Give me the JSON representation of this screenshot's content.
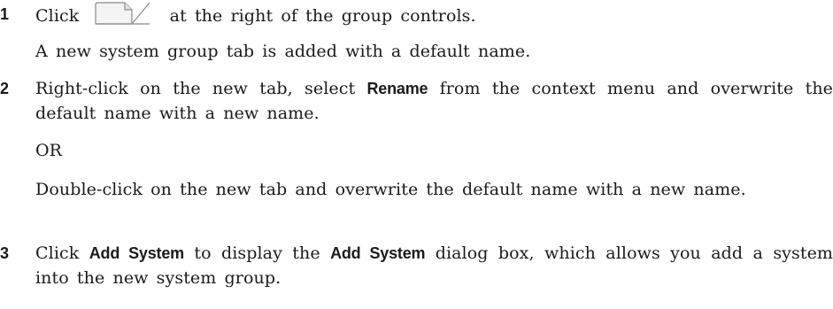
{
  "steps": [
    {
      "number": "1",
      "line_a_pre": "Click",
      "icon": "new-tab-icon",
      "line_a_post": "at the right of the group controls.",
      "line_b": "A new system group tab is added with a default name."
    },
    {
      "number": "2",
      "p1_pre": "Right-click on the new tab, select",
      "p1_term": "Rename",
      "p1_post": "from the context menu and overwrite the default name with a new name.",
      "or": "OR",
      "p3": "Double-click on the new tab and overwrite the default name with a new name."
    },
    {
      "number": "3",
      "p1_pre": "Click",
      "p1_term1": "Add System",
      "p1_mid": "to display the",
      "p1_term2": "Add System",
      "p1_post": "dialog box, which allows you add a system into the new system group."
    }
  ]
}
